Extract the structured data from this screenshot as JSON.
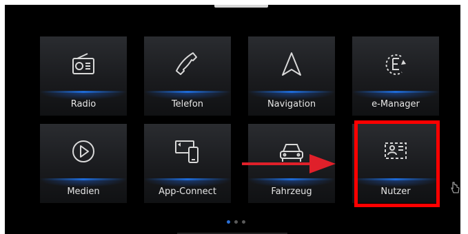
{
  "tiles": [
    {
      "id": "radio",
      "label": "Radio",
      "icon": "radio-icon"
    },
    {
      "id": "telefon",
      "label": "Telefon",
      "icon": "phone-icon"
    },
    {
      "id": "navigation",
      "label": "Navigation",
      "icon": "navigation-arrow-icon"
    },
    {
      "id": "e-manager",
      "label": "e-Manager",
      "icon": "e-manager-icon"
    },
    {
      "id": "medien",
      "label": "Medien",
      "icon": "play-icon"
    },
    {
      "id": "app-connect",
      "label": "App-Connect",
      "icon": "app-connect-icon"
    },
    {
      "id": "fahrzeug",
      "label": "Fahrzeug",
      "icon": "car-icon"
    },
    {
      "id": "nutzer",
      "label": "Nutzer",
      "icon": "user-profile-icon"
    }
  ],
  "pagination": {
    "pages": 3,
    "active": 1
  },
  "annotation": {
    "highlight_color": "#ff0000",
    "arrow_color": "#e0202a"
  },
  "colors": {
    "accent": "#1e6bd8",
    "background": "#000000",
    "label": "#e6e6e6"
  }
}
